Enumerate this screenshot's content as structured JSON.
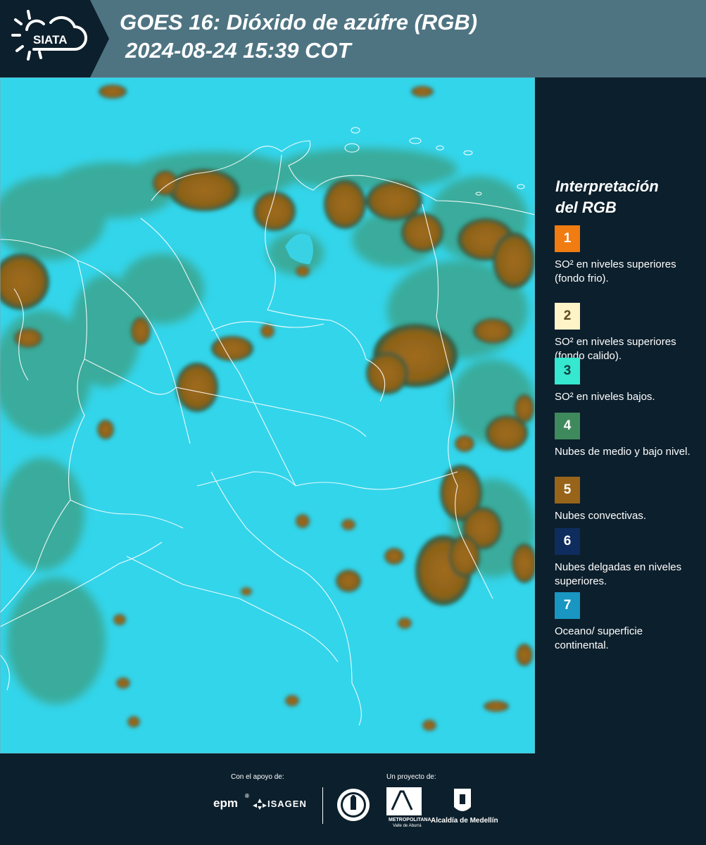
{
  "header": {
    "logo_text": "SIATA",
    "title_line1": "GOES 16: Dióxido de azúfre (RGB)",
    "title_line2": "2024-08-24 15:39 COT"
  },
  "legend": {
    "title_line1": "Interpretación",
    "title_line2": "del RGB",
    "items": [
      {
        "number": "1",
        "color": "#f07c12",
        "text_color": "#ffffff",
        "label": "SO² en niveles superiores (fondo frio)."
      },
      {
        "number": "2",
        "color": "#fff3c8",
        "text_color": "#5a4a1e",
        "label": "SO² en niveles superiores (fondo calido)."
      },
      {
        "number": "3",
        "color": "#35e8cf",
        "text_color": "#0e3b3a",
        "label": "SO² en niveles bajos."
      },
      {
        "number": "4",
        "color": "#3f8a5c",
        "text_color": "#ffffff",
        "label": "Nubes de medio y bajo nivel."
      },
      {
        "number": "5",
        "color": "#98641a",
        "text_color": "#ffffff",
        "label": "Nubes convectivas."
      },
      {
        "number": "6",
        "color": "#0e2d5e",
        "text_color": "#ffffff",
        "label": "Nubes delgadas en niveles superiores."
      },
      {
        "number": "7",
        "color": "#1996c1",
        "text_color": "#ffffff",
        "label": "Oceano/ superficie continental."
      }
    ]
  },
  "footer": {
    "support_label": "Con el apoyo de:",
    "project_label": "Un proyecto de:",
    "sponsor_1": "epm",
    "sponsor_2": "ISAGEN",
    "project_1": "Área",
    "project_1_sub": "METROPOLITANA",
    "project_1_sub2": "Valle de Aburrá",
    "project_2": "Alcaldía de Medellín"
  },
  "colors": {
    "header_bg": "#4e7482",
    "panel_bg": "#0c1f2c",
    "map_surface": "#2fd2e8",
    "convective_cloud": "#98641a",
    "mid_low_cloud": "#3f8a5c",
    "borders": "#ffffff"
  }
}
